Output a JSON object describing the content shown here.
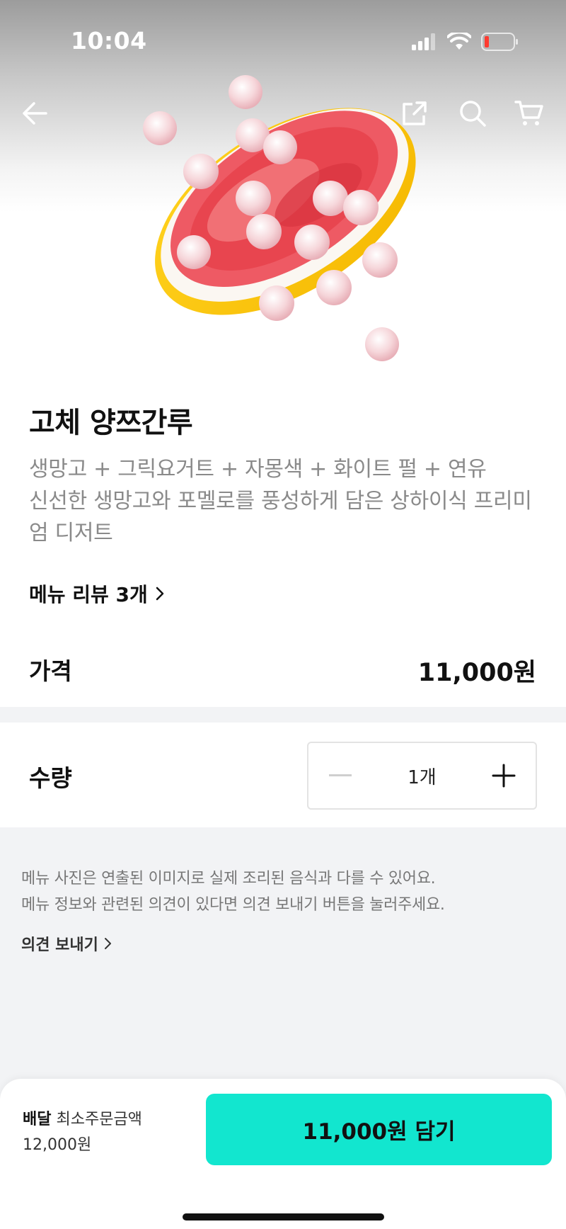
{
  "status_bar": {
    "time": "10:04"
  },
  "product": {
    "title": "고체 양쯔간루",
    "description_line1": "생망고 + 그릭요거트 + 자몽색 + 화이트 펄 + 연유",
    "description_line2": "신선한 생망고와 포멜로를 풍성하게 담은 상하이식 프리미엄 디저트",
    "review_link": "메뉴 리뷰 3개",
    "price_label": "가격",
    "price_value": "11,000원"
  },
  "quantity": {
    "label": "수량",
    "value": "1개"
  },
  "notice": {
    "line1": "메뉴 사진은 연출된 이미지로 실제 조리된 음식과 다를 수 있어요.",
    "line2": "메뉴 정보와 관련된 의견이 있다면 의견 보내기 버튼을 눌러주세요.",
    "feedback_link": "의견 보내기"
  },
  "bottom_bar": {
    "delivery_label": "배달",
    "min_order_label": "최소주문금액",
    "min_order_value": "12,000원",
    "cart_button": "11,000원 담기"
  },
  "colors": {
    "accent": "#12e6cf",
    "background": "#f2f3f5"
  }
}
